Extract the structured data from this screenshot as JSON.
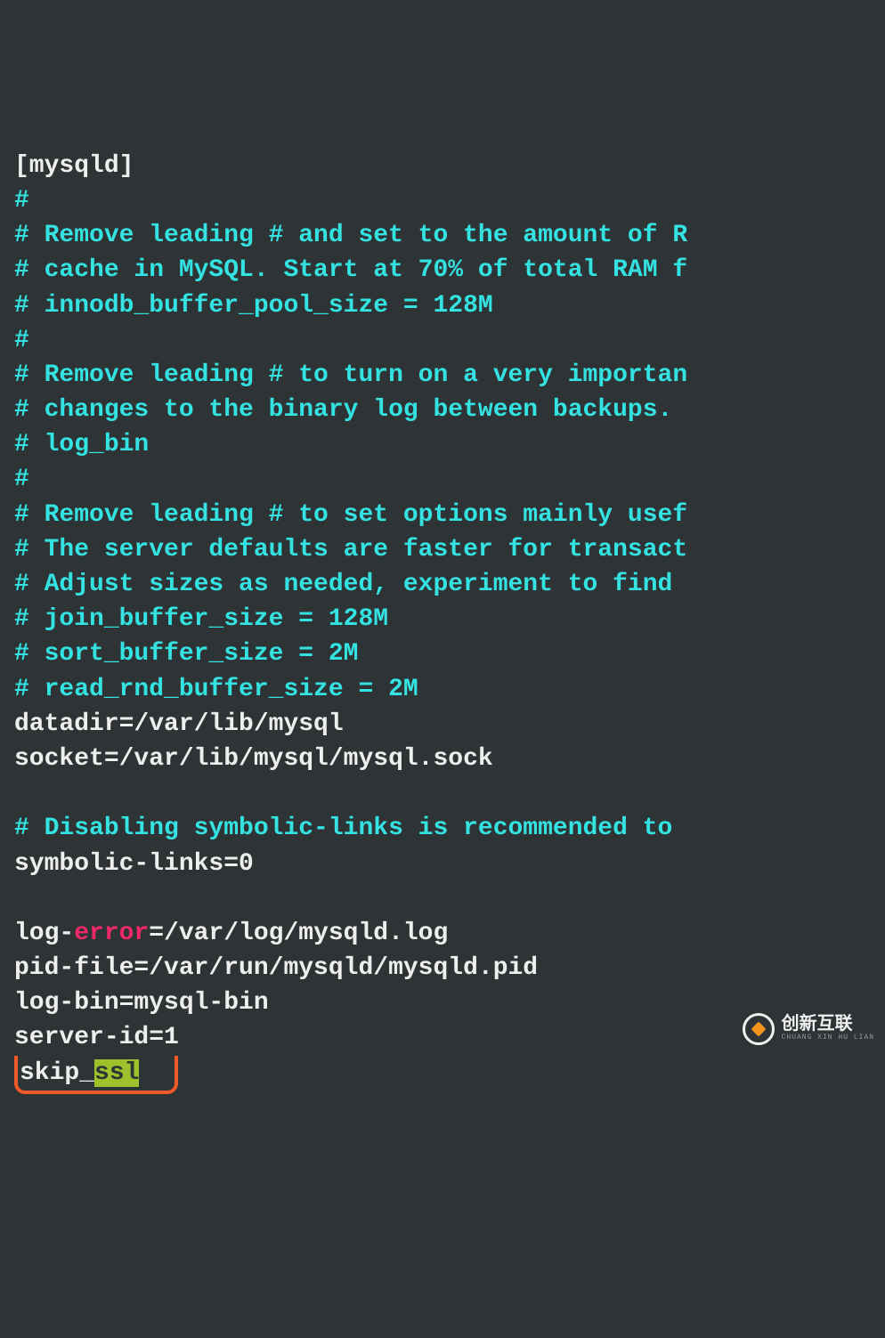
{
  "watermark": {
    "main": "创新互联",
    "sub": "CHUANG XIN HU LIAN"
  },
  "line1": "[mysqld]",
  "line2": "#",
  "line3": "# Remove leading # and set to the amount of R",
  "line4": "# cache in MySQL. Start at 70% of total RAM f",
  "line5": "# innodb_buffer_pool_size = 128M",
  "line6": "#",
  "line7": "# Remove leading # to turn on a very importan",
  "line8": "# changes to the binary log between backups.",
  "line9": "# log_bin",
  "line10": "#",
  "line11": "# Remove leading # to set options mainly usef",
  "line12": "# The server defaults are faster for transact",
  "line13": "# Adjust sizes as needed, experiment to find ",
  "line14": "# join_buffer_size = 128M",
  "line15": "# sort_buffer_size = 2M",
  "line16": "# read_rnd_buffer_size = 2M",
  "line17": "datadir=/var/lib/mysql",
  "line18": "socket=/var/lib/mysql/mysql.sock",
  "line19": "",
  "line20": "# Disabling symbolic-links is recommended to ",
  "line21": "symbolic-links=0",
  "line22": "",
  "line23a": "log-",
  "line23b": "error",
  "line23c": "=/var/log/mysqld.log",
  "line24": "pid-file=/var/run/mysqld/mysqld.pid",
  "line25": "log-bin=mysql-bin",
  "line26": "server-id=1",
  "line27a": "skip_",
  "line27b": "ssl"
}
